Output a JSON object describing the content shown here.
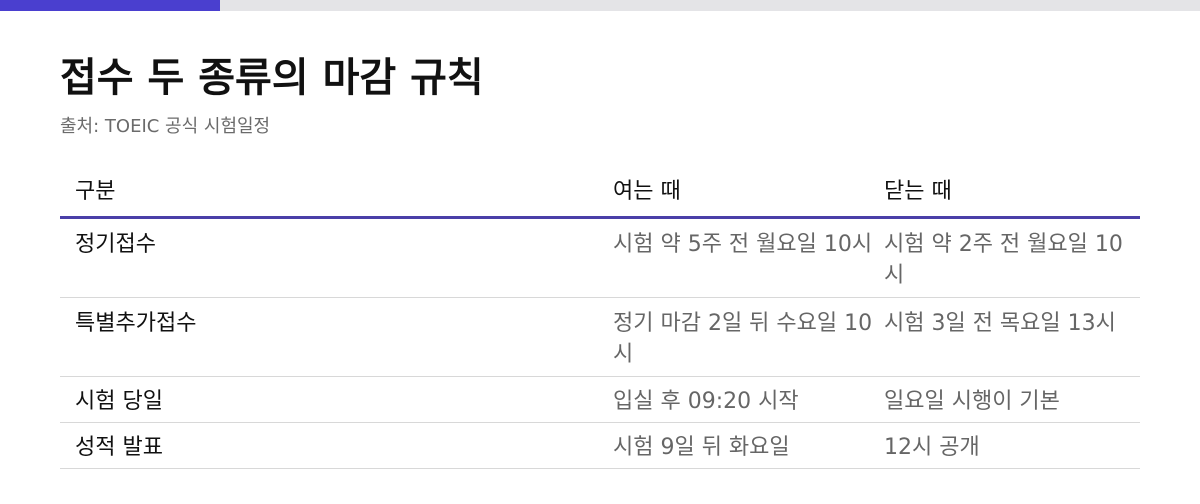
{
  "accent_color": "#4a3fcf",
  "progress": 0.183,
  "title": "접수 두 종류의 마감 규칙",
  "source": "출처: TOEIC 공식 시험일정",
  "table": {
    "headers": [
      "구분",
      "여는 때",
      "닫는 때"
    ],
    "rows": [
      [
        "정기접수",
        "시험 약 5주 전 월요일 10시",
        "시험 약 2주 전 월요일 10시"
      ],
      [
        "특별추가접수",
        "정기 마감 2일 뒤 수요일 10시",
        "시험 3일 전 목요일 13시"
      ],
      [
        "시험 당일",
        "입실 후 09:20 시작",
        "일요일 시행이 기본"
      ],
      [
        "성적 발표",
        "시험 9일 뒤 화요일",
        "12시 공개"
      ]
    ]
  }
}
